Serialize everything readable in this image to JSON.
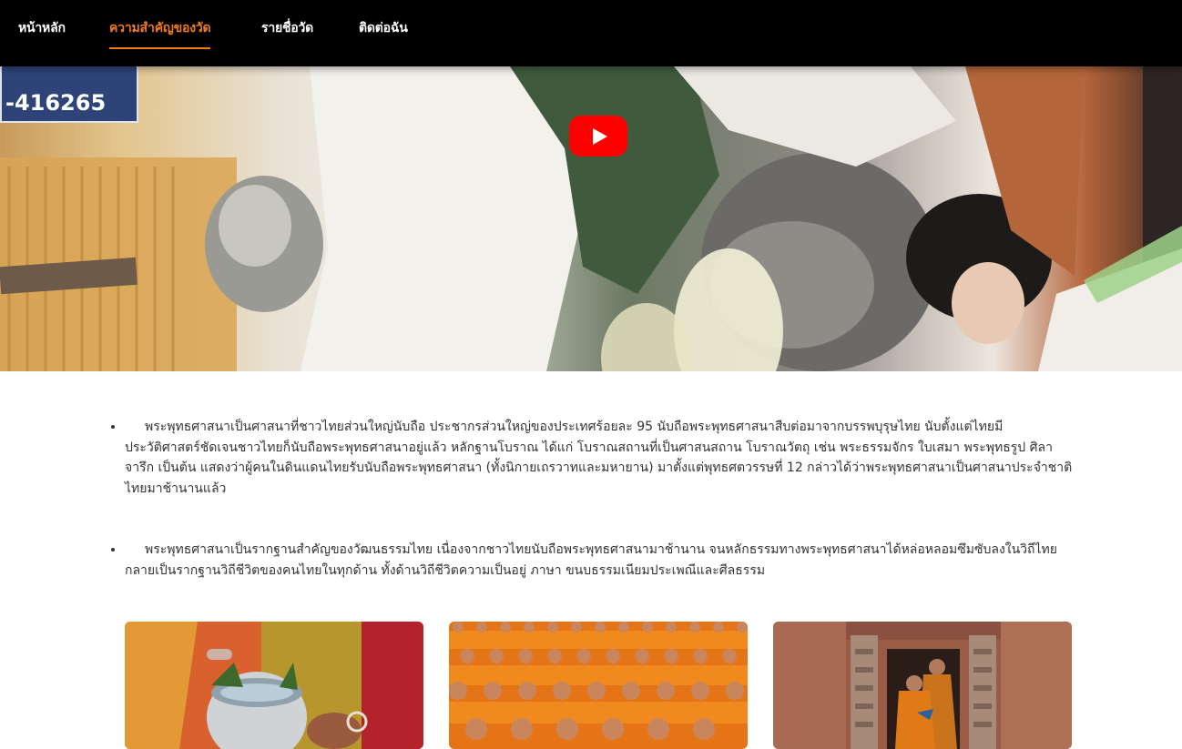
{
  "nav": {
    "items": [
      {
        "label": "หน้าหลัก",
        "active": false
      },
      {
        "label": "ความสำคัญของวัด",
        "active": true
      },
      {
        "label": "รายชื่อวัด",
        "active": false
      },
      {
        "label": "ติดต่อฉัน",
        "active": false
      }
    ],
    "accent_color": "#f07c1e"
  },
  "hero_video": {
    "sign_text": "-416265",
    "play_icon": "youtube-play-icon"
  },
  "content": {
    "paragraphs": [
      "พระพุทธศาสนาเป็นศาสนาที่ชาวไทยส่วนใหญ่นับถือ ประชากรส่วนใหญ่ของประเทศร้อยละ 95 นับถือพระพุทธศาสนาสืบต่อมาจากบรรพบุรุษไทย นับตั้งแต่ไทยมีประวัติศาสตร์ชัดเจนชาวไทยก็นับถือพระพุทธศาสนาอยู่แล้ว หลักฐานโบราณ ได้แก่ โบราณสถานที่เป็นศาสนสถาน โบราณวัตถุ เช่น พระธรรมจักร ใบเสมา พระพุทธรูป ศิลาจารึก เป็นต้น แสดงว่าผู้คนในดินแดนไทยรับนับถือพระพุทธศาสนา (ทั้งนิกายเถรวาทและมหายาน) มาตั้งแต่พุทธศตวรรษที่ 12 กล่าวได้ว่าพระพุทธศาสนาเป็นศาสนาประจำชาติไทยมาช้านานแล้ว",
      "พระพุทธศาสนาเป็นรากฐานสำคัญของวัฒนธรรมไทย เนื่องจากชาวไทยนับถือพระพุทธศาสนามาช้านาน จนหลักธรรมทางพระพุทธศาสนาได้หล่อหลอมซึมซับลงในวิถีไทยกลายเป็นรากฐานวิถีชีวิตของคนไทยในทุกด้าน ทั้งด้านวิถีชีวิตความเป็นอยู่ ภาษา ขนบธรรมเนียมประเพณีและศีลธรรม"
    ]
  },
  "gallery": {
    "images": [
      "water-pouring-ceremony-photo",
      "monks-gathering-photo",
      "monk-at-temple-door-photo"
    ]
  }
}
